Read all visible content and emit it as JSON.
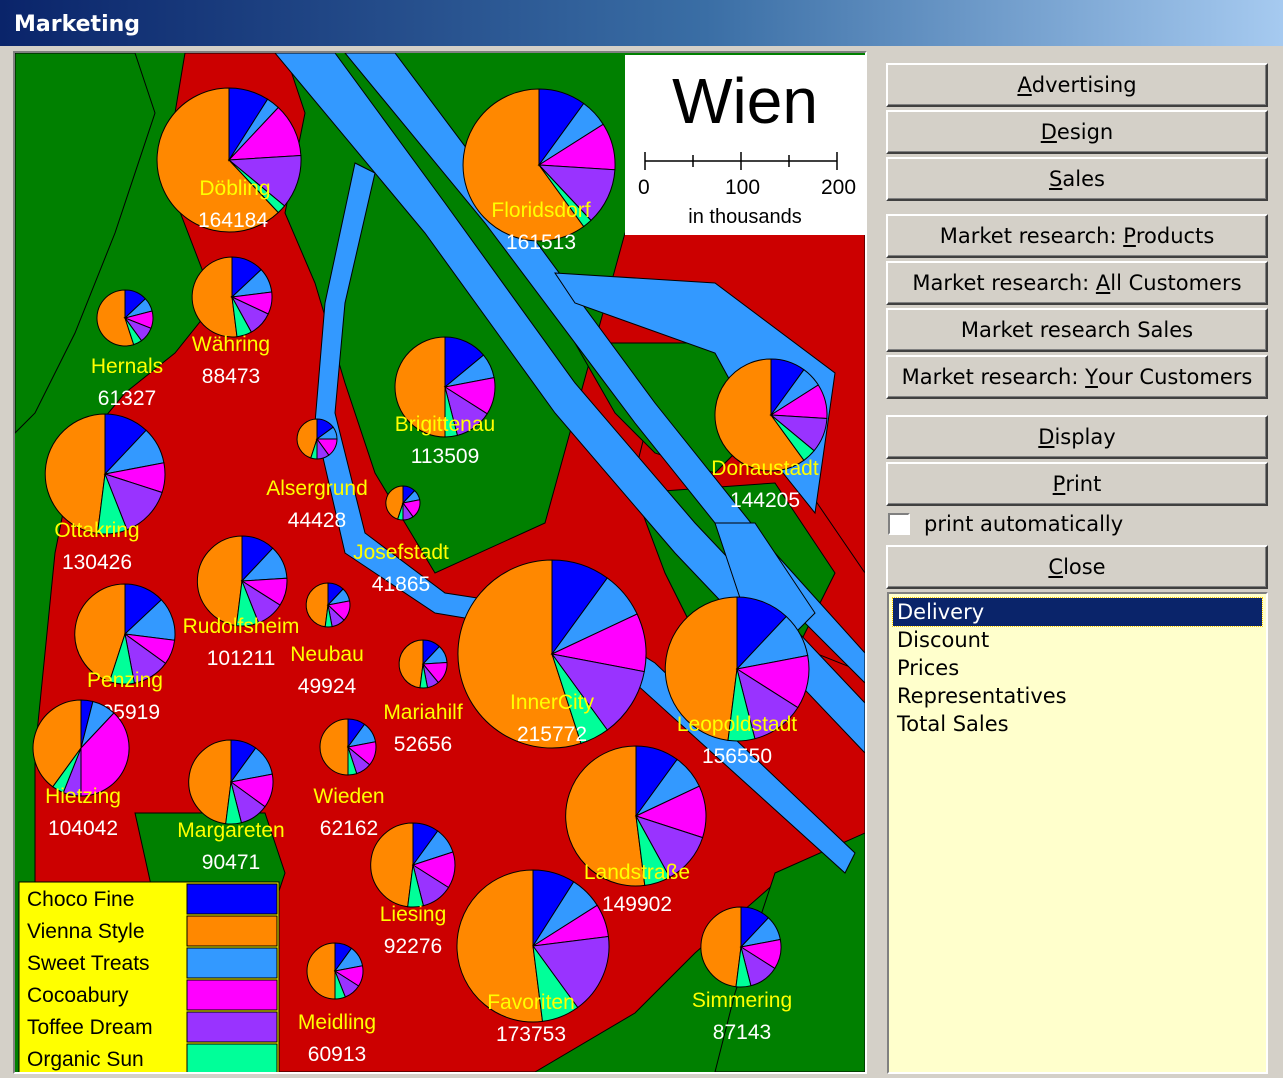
{
  "window": {
    "title": "Marketing"
  },
  "map": {
    "title": "Wien",
    "scale": {
      "ticks": [
        "0",
        "100",
        "200"
      ],
      "unit": "in thousands"
    },
    "colors": {
      "land": "#cc0000",
      "park": "#008000",
      "water": "#3399ff"
    },
    "products": [
      {
        "name": "Choco Fine",
        "color": "#0000ff"
      },
      {
        "name": "Vienna Style",
        "color": "#ff8800"
      },
      {
        "name": "Sweet Treats",
        "color": "#3399ff"
      },
      {
        "name": "Cocoabury",
        "color": "#ff00ff"
      },
      {
        "name": "Toffee Dream",
        "color": "#9933ff"
      },
      {
        "name": "Organic Sun",
        "color": "#00ff99"
      }
    ],
    "districts": [
      {
        "name": "Döbling",
        "value": "164184",
        "shares": [
          0.09,
          0.62,
          0.03,
          0.12,
          0.12,
          0.02
        ]
      },
      {
        "name": "Floridsdorf",
        "value": "161513",
        "shares": [
          0.1,
          0.6,
          0.06,
          0.1,
          0.12,
          0.02
        ]
      },
      {
        "name": "Hernals",
        "value": "61327",
        "shares": [
          0.13,
          0.55,
          0.08,
          0.1,
          0.09,
          0.05
        ]
      },
      {
        "name": "Währing",
        "value": "88473",
        "shares": [
          0.13,
          0.52,
          0.1,
          0.09,
          0.1,
          0.06
        ]
      },
      {
        "name": "Brigittenau",
        "value": "113509",
        "shares": [
          0.14,
          0.5,
          0.08,
          0.12,
          0.12,
          0.04
        ]
      },
      {
        "name": "Donaustadt",
        "value": "144205",
        "shares": [
          0.1,
          0.6,
          0.06,
          0.1,
          0.1,
          0.04
        ]
      },
      {
        "name": "Alsergrund",
        "value": "44428",
        "shares": [
          0.15,
          0.45,
          0.1,
          0.15,
          0.1,
          0.05
        ]
      },
      {
        "name": "Ottakring",
        "value": "130426",
        "shares": [
          0.12,
          0.48,
          0.1,
          0.08,
          0.14,
          0.08
        ]
      },
      {
        "name": "Josefstadt",
        "value": "41865",
        "shares": [
          0.12,
          0.45,
          0.1,
          0.18,
          0.1,
          0.05
        ]
      },
      {
        "name": "Rudolfsheim",
        "value": "101211",
        "shares": [
          0.12,
          0.48,
          0.12,
          0.1,
          0.1,
          0.08
        ]
      },
      {
        "name": "Neubau",
        "value": "49924",
        "shares": [
          0.12,
          0.48,
          0.1,
          0.15,
          0.1,
          0.05
        ]
      },
      {
        "name": "Penzing",
        "value": "105919",
        "shares": [
          0.13,
          0.45,
          0.14,
          0.08,
          0.12,
          0.08
        ]
      },
      {
        "name": "InnerCity",
        "value": "215772",
        "shares": [
          0.1,
          0.55,
          0.08,
          0.1,
          0.12,
          0.05
        ]
      },
      {
        "name": "Leopoldstadt",
        "value": "156550",
        "shares": [
          0.12,
          0.48,
          0.1,
          0.12,
          0.12,
          0.06
        ]
      },
      {
        "name": "Mariahilf",
        "value": "52656",
        "shares": [
          0.12,
          0.48,
          0.12,
          0.15,
          0.08,
          0.05
        ]
      },
      {
        "name": "Hietzing",
        "value": "104042",
        "shares": [
          0.04,
          0.4,
          0.08,
          0.38,
          0.06,
          0.04
        ]
      },
      {
        "name": "Wieden",
        "value": "62162",
        "shares": [
          0.1,
          0.5,
          0.12,
          0.14,
          0.09,
          0.05
        ]
      },
      {
        "name": "Margareten",
        "value": "90471",
        "shares": [
          0.1,
          0.48,
          0.12,
          0.13,
          0.11,
          0.06
        ]
      },
      {
        "name": "Landstraße",
        "value": "149902",
        "shares": [
          0.1,
          0.52,
          0.08,
          0.12,
          0.12,
          0.06
        ]
      },
      {
        "name": "Liesing",
        "value": "92276",
        "shares": [
          0.1,
          0.48,
          0.1,
          0.14,
          0.12,
          0.06
        ]
      },
      {
        "name": "Favoriten",
        "value": "173753",
        "shares": [
          0.09,
          0.52,
          0.07,
          0.07,
          0.17,
          0.08
        ]
      },
      {
        "name": "Simmering",
        "value": "87143",
        "shares": [
          0.12,
          0.48,
          0.1,
          0.12,
          0.12,
          0.06
        ]
      },
      {
        "name": "Meidling",
        "value": "60913",
        "shares": [
          0.1,
          0.5,
          0.12,
          0.12,
          0.1,
          0.06
        ]
      }
    ]
  },
  "buttons": {
    "advertising": {
      "pre": "",
      "key": "A",
      "post": "dvertising"
    },
    "design": {
      "pre": "",
      "key": "D",
      "post": "esign"
    },
    "sales": {
      "pre": "",
      "key": "S",
      "post": "ales"
    },
    "mr_products": {
      "pre": "Market research: ",
      "key": "P",
      "post": "roducts"
    },
    "mr_all_customers": {
      "pre": "Market research: ",
      "key": "A",
      "post": "ll Customers"
    },
    "mr_sales": {
      "pre": "Market research Sales",
      "key": "",
      "post": ""
    },
    "mr_your_customers": {
      "pre": "Market research: ",
      "key": "Y",
      "post": "our Customers"
    },
    "display": {
      "pre": "",
      "key": "D",
      "post": "isplay"
    },
    "print": {
      "pre": "",
      "key": "P",
      "post": "rint"
    },
    "close": {
      "pre": "",
      "key": "C",
      "post": "lose"
    }
  },
  "print_automatically": {
    "label": "print automatically",
    "checked": false
  },
  "list": {
    "items": [
      "Delivery",
      "Discount",
      "Prices",
      "Representatives",
      "Total Sales"
    ],
    "selected": "Delivery"
  }
}
